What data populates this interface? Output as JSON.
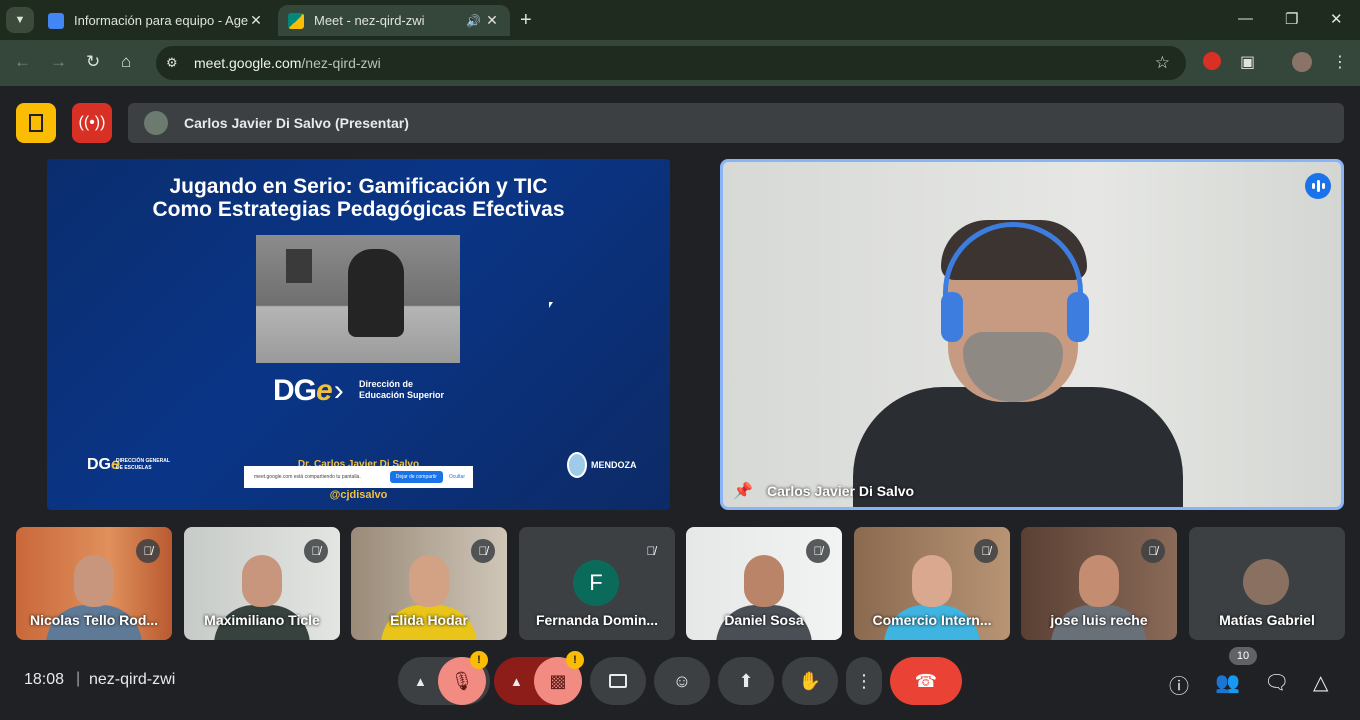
{
  "browser": {
    "tabs": [
      {
        "title": "Información para equipo - Agen",
        "icon": "docs-icon",
        "color": "#4285f4"
      },
      {
        "title": "Meet - nez-qird-zwi",
        "icon": "meet-icon",
        "color": "#00897b",
        "active": true
      }
    ],
    "url_host": "meet.google.com",
    "url_path": "/nez-qird-zwi"
  },
  "meet": {
    "presenter_label": "Carlos Javier Di Salvo (Presentar)",
    "slide": {
      "title_line1": "Jugando en Serio: Gamificación y TIC",
      "title_line2": "Como Estrategias Pedagógicas Efectivas",
      "logo_text_a": "DG",
      "logo_text_b": "e",
      "logo_sub_line1": "Dirección de",
      "logo_sub_line2": "Educación Superior",
      "small_logo_sub_line1": "DIRECCIÓN GENERAL",
      "small_logo_sub_line2": "DE ESCUELAS",
      "author": "Dr. Carlos Javier Di Salvo",
      "handle": "@cjdisalvo",
      "province": "MENDOZA",
      "share_msg": "meet.google.com está compartiendo tu pantalla.",
      "share_stop": "Dejar de compartir",
      "share_hide": "Ocultar"
    },
    "speaker_name": "Carlos Javier Di Salvo",
    "participants": [
      {
        "name": "Nicolas Tello Rod...",
        "muted": true
      },
      {
        "name": "Maximiliano Ticle",
        "muted": true
      },
      {
        "name": "Elida Hodar",
        "muted": true
      },
      {
        "name": "Fernanda Domin...",
        "muted": true,
        "initial": "F"
      },
      {
        "name": "Daniel Sosa",
        "muted": true
      },
      {
        "name": "Comercio Intern...",
        "muted": true
      },
      {
        "name": "jose luis reche",
        "muted": true
      },
      {
        "name": "Matías Gabriel",
        "muted": false
      }
    ],
    "time": "18:08",
    "meeting_code": "nez-qird-zwi",
    "people_count": "10",
    "colors": {
      "end_call": "#ea4335",
      "mic_off": "#f28b82",
      "accent": "#8ab4f8",
      "warning": "#fbbc04"
    }
  }
}
